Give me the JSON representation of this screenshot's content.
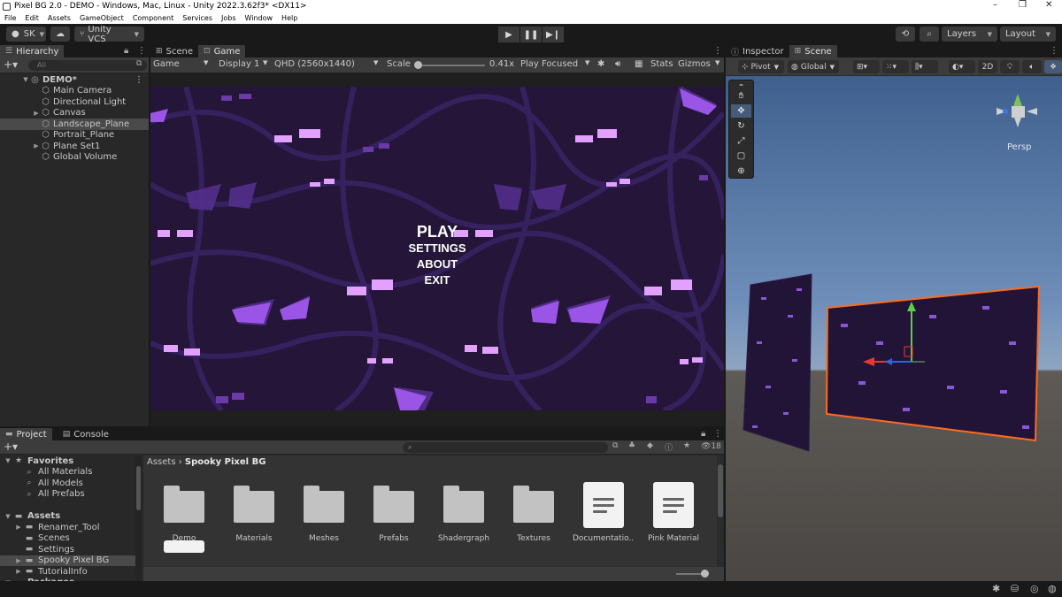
{
  "window": {
    "title": "Pixel BG 2.0 - DEMO - Windows, Mac, Linux - Unity 2022.3.62f3* <DX11>",
    "controls": [
      "–",
      "❐",
      "✕"
    ]
  },
  "menu": [
    "File",
    "Edit",
    "Assets",
    "GameObject",
    "Component",
    "Services",
    "Jobs",
    "Window",
    "Help"
  ],
  "toolbar": {
    "account": "SK",
    "vcs": "Unity VCS",
    "layers": "Layers",
    "layout": "Layout"
  },
  "hierarchy": {
    "tab": "Hierarchy",
    "search_placeholder": "All",
    "scene": "DEMO*",
    "items": [
      {
        "label": "Main Camera",
        "expandable": false
      },
      {
        "label": "Directional Light",
        "expandable": false
      },
      {
        "label": "Canvas",
        "expandable": true
      },
      {
        "label": "Landscape_Plane",
        "expandable": false,
        "selected": true
      },
      {
        "label": "Portrait_Plane",
        "expandable": false
      },
      {
        "label": "Plane Set1",
        "expandable": true
      },
      {
        "label": "Global Volume",
        "expandable": false
      }
    ]
  },
  "game": {
    "tabs": [
      "Scene",
      "Game"
    ],
    "view_mode": "Game",
    "display": "Display 1",
    "resolution": "QHD (2560x1440)",
    "scale_label": "Scale",
    "scale_value": "0.41x",
    "play_focused": "Play Focused",
    "stats": "Stats",
    "gizmos": "Gizmos",
    "menu_items": [
      "PLAY",
      "SETTINGS",
      "ABOUT",
      "EXIT"
    ]
  },
  "inspector": {
    "tabs": [
      "Inspector",
      "Scene"
    ],
    "pivot": "Pivot",
    "global": "Global",
    "mode_2d": "2D",
    "persp": "Persp"
  },
  "project": {
    "tabs": [
      "Project",
      "Console"
    ],
    "hidden_count": "18",
    "tree": [
      {
        "label": "Favorites",
        "level": 0,
        "bold": true,
        "expanded": true,
        "icon": "star"
      },
      {
        "label": "All Materials",
        "level": 1,
        "icon": "search"
      },
      {
        "label": "All Models",
        "level": 1,
        "icon": "search"
      },
      {
        "label": "All Prefabs",
        "level": 1,
        "icon": "search"
      },
      {
        "label": "",
        "level": 0,
        "icon": "none"
      },
      {
        "label": "Assets",
        "level": 0,
        "bold": true,
        "expanded": true,
        "icon": "folder"
      },
      {
        "label": "Renamer_Tool",
        "level": 1,
        "arrow": true,
        "icon": "folder"
      },
      {
        "label": "Scenes",
        "level": 1,
        "icon": "folder"
      },
      {
        "label": "Settings",
        "level": 1,
        "icon": "folder"
      },
      {
        "label": "Spooky Pixel BG",
        "level": 1,
        "arrow": true,
        "icon": "folder",
        "selected": true
      },
      {
        "label": "TutorialInfo",
        "level": 1,
        "arrow": true,
        "icon": "folder"
      },
      {
        "label": "Packages",
        "level": 0,
        "bold": true,
        "expanded": true,
        "icon": "folder"
      }
    ],
    "breadcrumb": {
      "root": "Assets",
      "current": "Spooky Pixel BG"
    },
    "assets": [
      {
        "label": "Demo",
        "kind": "folder"
      },
      {
        "label": "Materials",
        "kind": "folder"
      },
      {
        "label": "Meshes",
        "kind": "folder"
      },
      {
        "label": "Prefabs",
        "kind": "folder"
      },
      {
        "label": "Shadergraph",
        "kind": "folder"
      },
      {
        "label": "Textures",
        "kind": "folder"
      },
      {
        "label": "Documentatio...",
        "kind": "doc"
      },
      {
        "label": "Pink Material",
        "kind": "doc"
      }
    ]
  }
}
